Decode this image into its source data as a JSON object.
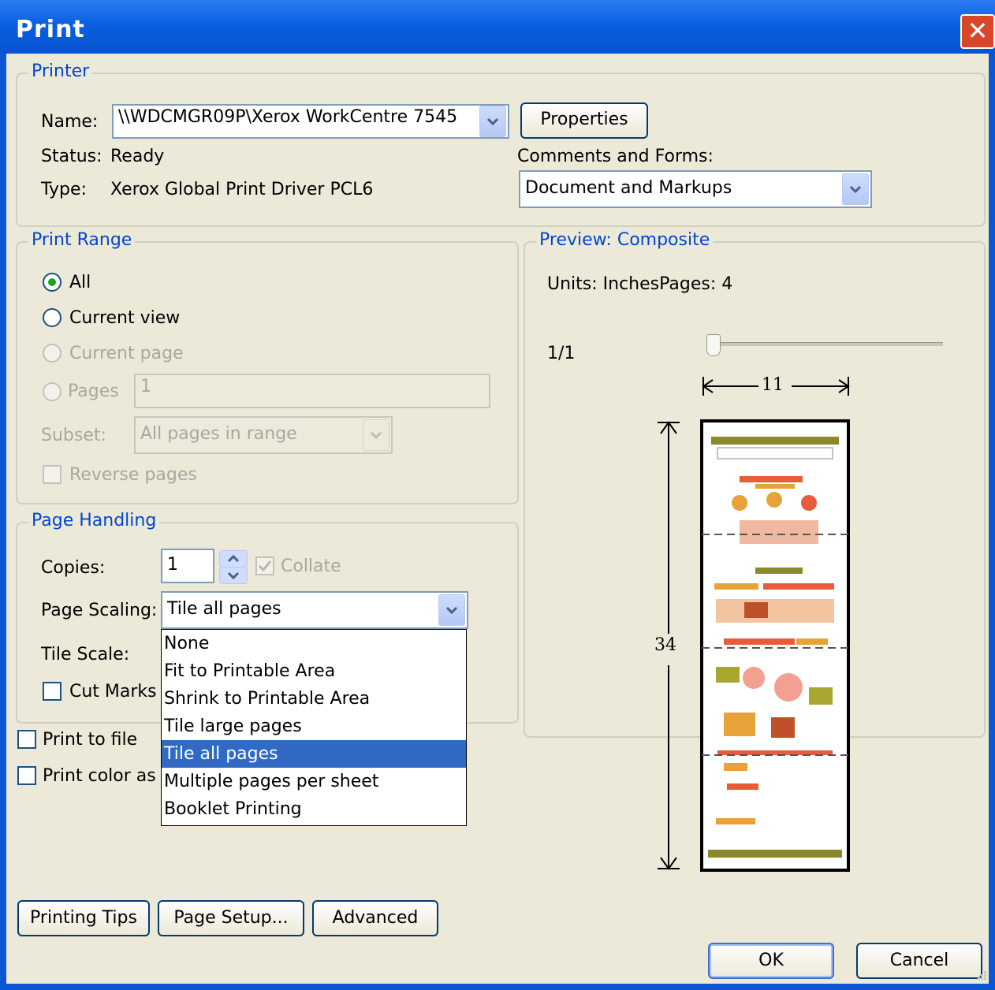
{
  "window": {
    "title": "Print",
    "close_symbol": "✕"
  },
  "printer": {
    "legend": "Printer",
    "name_label": "Name:",
    "name_value": "\\\\WDCMGR09P\\Xerox WorkCentre 7545",
    "properties_label": "Properties",
    "status_label": "Status:",
    "status_value": "Ready",
    "type_label": "Type:",
    "type_value": "Xerox Global Print Driver PCL6",
    "comments_label": "Comments and Forms:",
    "comments_value": "Document and Markups"
  },
  "print_range": {
    "legend": "Print Range",
    "all_label": "All",
    "current_view_label": "Current view",
    "current_page_label": "Current page",
    "pages_label": "Pages",
    "pages_value": "1",
    "subset_label": "Subset:",
    "subset_value": "All pages in range",
    "reverse_label": "Reverse pages"
  },
  "page_handling": {
    "legend": "Page Handling",
    "copies_label": "Copies:",
    "copies_value": "1",
    "collate_label": "Collate",
    "scaling_label": "Page Scaling:",
    "scaling_value": "Tile all pages",
    "tile_scale_label": "Tile Scale:",
    "cut_marks_label": "Cut Marks",
    "scaling_options": [
      "None",
      "Fit to Printable Area",
      "Shrink to Printable Area",
      "Tile large pages",
      "Tile all pages",
      "Multiple pages per sheet",
      "Booklet Printing"
    ],
    "selected_option": "Tile all pages"
  },
  "print_to_file_label": "Print to file",
  "print_color_label": "Print color as b",
  "preview": {
    "legend": "Preview: Composite",
    "units_text": "Units: InchesPages: 4",
    "page_counter": "1/1",
    "slider_value": 0,
    "width_label": "11",
    "height_label": "34"
  },
  "buttons": {
    "printing_tips": "Printing Tips",
    "page_setup": "Page Setup...",
    "advanced": "Advanced",
    "ok": "OK",
    "cancel": "Cancel"
  },
  "icons": [
    "close-icon",
    "dropdown-arrow-icon",
    "spinner-up-icon",
    "spinner-down-icon",
    "check-icon",
    "resize-grip-icon"
  ]
}
